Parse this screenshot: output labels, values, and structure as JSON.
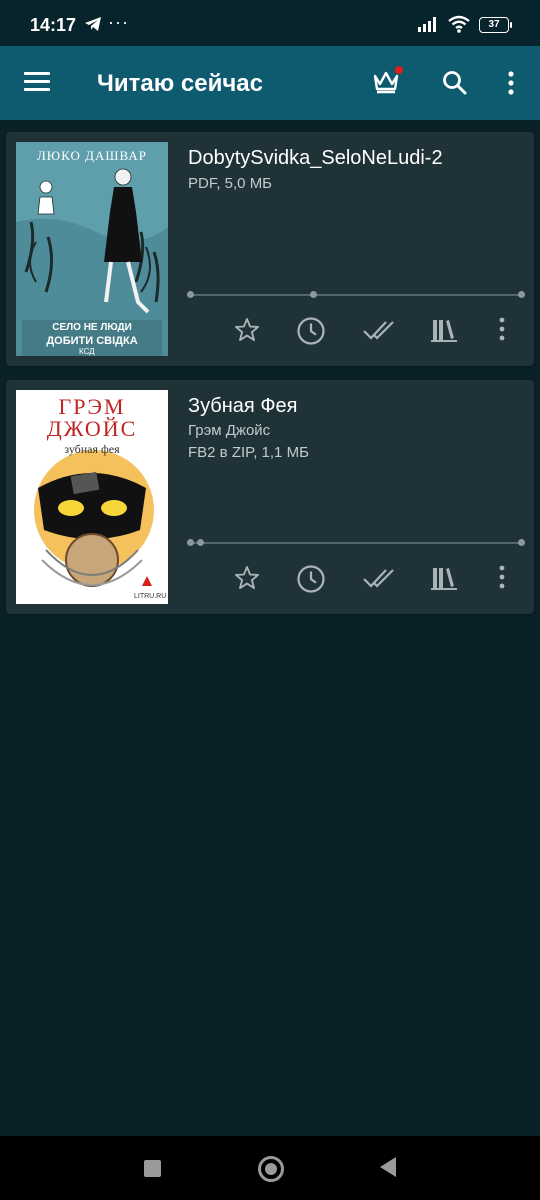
{
  "status_bar": {
    "time": "14:17",
    "notification_dots": "···",
    "battery": "37"
  },
  "app_bar": {
    "title": "Читаю сейчас"
  },
  "books": [
    {
      "title": "DobytySvidka_SeloNeLudi-2",
      "meta_lines": [
        "PDF, 5,0 МБ"
      ],
      "cover": {
        "author": "ЛЮКО ДАШВАР",
        "title_line1": "СЕЛО НЕ ЛЮДИ",
        "title_line2": "ДОБИТИ СВІДКА",
        "publisher": "КСД",
        "background": "#5f9fac"
      },
      "progress": 0.37
    },
    {
      "title": "Зубная Фея",
      "meta_lines": [
        "Грэм Джойс",
        "FB2 в ZIP, 1,1 МБ"
      ],
      "cover": {
        "author_line1": "ГРЭМ",
        "author_line2": "ДЖОЙС",
        "title": "зубная фея",
        "publisher": "LITRU.RU",
        "background": "#ffffff"
      },
      "progress": 0.03
    }
  ],
  "colors": {
    "app_bar": "#0e5a6e",
    "background": "#0b2128",
    "card": "#1f3238",
    "notification": "#e21c1c"
  },
  "icons": [
    "menu-icon",
    "crown-icon",
    "search-icon",
    "more-vert-icon",
    "star-icon",
    "clock-icon",
    "done-all-icon",
    "library-icon"
  ]
}
